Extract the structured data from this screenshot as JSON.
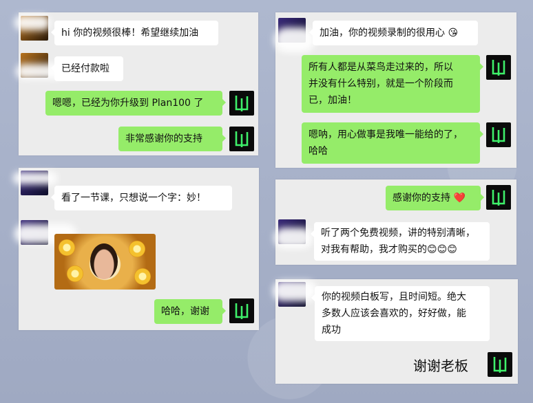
{
  "panels": [
    {
      "messages": [
        {
          "from": "customer",
          "text": "hi 你的视频很棒！希望继续加油"
        },
        {
          "from": "customer",
          "text": "已经付款啦"
        },
        {
          "from": "me",
          "text": "嗯嗯，已经为你升级到 Plan100 了"
        },
        {
          "from": "me",
          "text": "非常感谢你的支持"
        }
      ]
    },
    {
      "messages": [
        {
          "from": "customer",
          "text": "加油，你的视频录制的很用心",
          "emoji": "😘"
        },
        {
          "from": "me",
          "lines": [
            "所有人都是从菜鸟走过来的，所以",
            "并没有什么特别，就是一个阶段而",
            "已，加油！"
          ]
        },
        {
          "from": "me",
          "lines": [
            "嗯呐，用心做事是我唯一能给的了，",
            "哈哈"
          ]
        }
      ]
    },
    {
      "messages": [
        {
          "from": "customer",
          "text": "看了一节课，只想说一个字：妙！"
        },
        {
          "from": "customer",
          "type": "photo"
        },
        {
          "from": "me",
          "text": "哈哈，谢谢"
        }
      ]
    },
    {
      "messages": [
        {
          "from": "me",
          "text": "感谢你的支持",
          "emoji": "❤️"
        },
        {
          "from": "customer",
          "lines": [
            "听了两个免费视频，讲的特别清晰，",
            "对我有帮助，我才购买的"
          ],
          "emoji": "😊😊😊"
        }
      ]
    },
    {
      "messages": [
        {
          "from": "customer",
          "lines": [
            "你的视频白板写，且时间短。绝大",
            "多数人应该会喜欢的，好好做，能",
            "成功"
          ]
        }
      ],
      "caption": "谢谢老板"
    }
  ],
  "colors": {
    "outgoing": "#95ec69",
    "incoming": "#ffffff",
    "panel": "#ececec"
  },
  "avatar_icon": "black-square-logo-icon"
}
